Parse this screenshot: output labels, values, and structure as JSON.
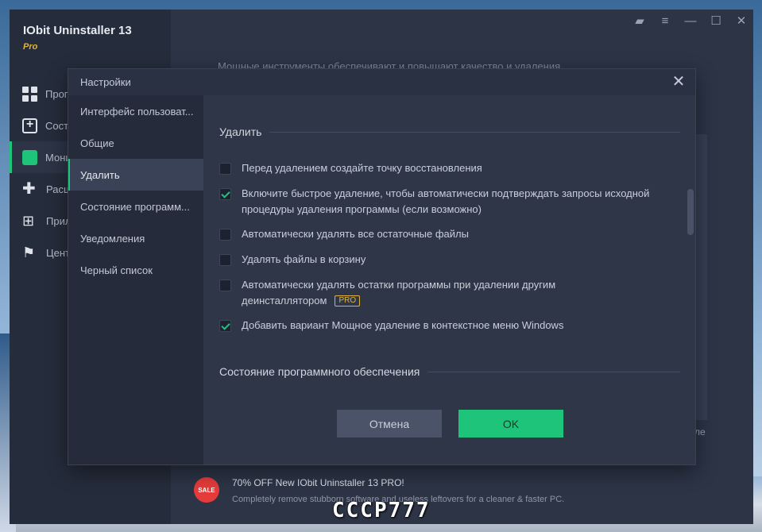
{
  "app": {
    "title": "IObit Uninstaller 13",
    "edition": "Pro",
    "content_text": "Мощные инструменты обеспечивают и повышают качество и удаления",
    "nav": [
      {
        "label": "Программы",
        "icon": "grid-icon"
      },
      {
        "label": "Состояние",
        "icon": "add-box-icon"
      },
      {
        "label": "Мониторинг",
        "icon": "chart-icon",
        "active": true
      },
      {
        "label": "Расширения",
        "icon": "puzzle-icon"
      },
      {
        "label": "Приложения Windows",
        "icon": "windows-icon"
      },
      {
        "label": "Центр действий",
        "icon": "flag-icon"
      }
    ],
    "titlebar": [
      "briefcase-icon",
      "menu-icon",
      "minimize-icon",
      "maximize-icon",
      "close-icon"
    ],
    "promo": {
      "badge": "SALE",
      "title": "70% OFF New IObit Uninstaller 13 PRO!",
      "subtitle": "Completely remove stubborn software and useless leftovers for a cleaner & faster PC."
    },
    "right_edge_text": "ле"
  },
  "dialog": {
    "title": "Настройки",
    "sidebar": [
      {
        "label": "Интерфейс пользоват..."
      },
      {
        "label": "Общие"
      },
      {
        "label": "Удалить",
        "active": true
      },
      {
        "label": "Состояние программ..."
      },
      {
        "label": "Уведомления"
      },
      {
        "label": "Черный список"
      }
    ],
    "section_uninstall": "Удалить",
    "options": [
      {
        "label": "Перед удалением создайте точку восстановления",
        "checked": false
      },
      {
        "label": "Включите быстрое удаление, чтобы автоматически подтверждать запросы исходной процедуры удаления программы (если возможно)",
        "checked": true
      },
      {
        "label": "Автоматически удалять все остаточные файлы",
        "checked": false
      },
      {
        "label": "Удалять файлы в корзину",
        "checked": false
      },
      {
        "label": "Автоматически удалять остатки программы при удалении другим деинсталлятором",
        "checked": false,
        "badge": "PRO"
      },
      {
        "label": "Добавить вариант Мощное удаление в контекстное меню Windows",
        "checked": true
      }
    ],
    "section_status": "Состояние программного обеспечения",
    "cancel_label": "Отмена",
    "ok_label": "OK"
  },
  "watermark": "СССР777",
  "colors": {
    "accent": "#1ec47a",
    "pro": "#e0b43a",
    "dialog_bg": "#2f3647"
  }
}
